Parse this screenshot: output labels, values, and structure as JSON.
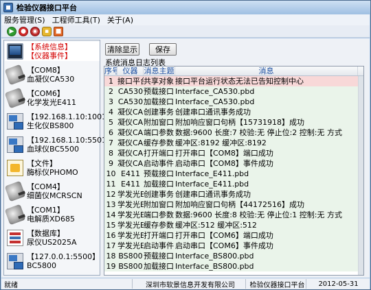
{
  "window": {
    "title": "检验仪器接口平台"
  },
  "menu": [
    {
      "label": "服务管理(S)"
    },
    {
      "label": "工程师工具(T)"
    },
    {
      "label": "关于(A)"
    }
  ],
  "toolbar": {
    "icons": [
      "play-icon",
      "stop-icon",
      "record-icon",
      "lock-icon",
      "exit-icon"
    ]
  },
  "devices": [
    {
      "line1": "【系统信息】",
      "line2": "【仪器事件】",
      "icon": "monitor-icon",
      "system": true
    },
    {
      "line1": "【COM8】",
      "line2": "血凝仪CA530",
      "icon": "serial-plug-icon"
    },
    {
      "line1": "【COM6】",
      "line2": "化学发光E411",
      "icon": "serial-plug-icon"
    },
    {
      "line1": "【192.168.1.10:1001】",
      "line2": "生化仪BS800",
      "icon": "network-icon"
    },
    {
      "line1": "【192.168.1.10:5501】",
      "line2": "血球仪BC5500",
      "icon": "network-icon"
    },
    {
      "line1": "【文件】",
      "line2": "酶标仪PHOMO",
      "icon": "file-icon"
    },
    {
      "line1": "【COM4】",
      "line2": "细菌仪MCRSCN",
      "icon": "serial-plug-icon"
    },
    {
      "line1": "【COM1】",
      "line2": "电解质XD685",
      "icon": "serial-plug-icon"
    },
    {
      "line1": "【数据库】",
      "line2": "尿仪US2025A",
      "icon": "database-icon"
    },
    {
      "line1": "【127.0.0.1:5500】",
      "line2": "BC5800",
      "icon": "network-icon"
    }
  ],
  "buttons": {
    "clear": "清除显示",
    "save": "保存"
  },
  "list": {
    "title": "系统消息日志列表",
    "columns": [
      "序号",
      "仪器",
      "消息主题",
      "消息"
    ],
    "rows": [
      {
        "no": "1",
        "device": "接口平台",
        "topic": "共享对象",
        "msg": "接口平台运行状态无法已告知控制中心",
        "highlight": true
      },
      {
        "no": "2",
        "device": "CA530",
        "topic": "预载接口",
        "msg": "Interface_CA530.pbd"
      },
      {
        "no": "3",
        "device": "CA530",
        "topic": "加载接口",
        "msg": "Interface_CA530.pbd"
      },
      {
        "no": "4",
        "device": "凝仪CA5",
        "topic": "创建事务",
        "msg": "创建串口通讯事务成功"
      },
      {
        "no": "5",
        "device": "凝仪CA5",
        "topic": "附加窗口",
        "msg": "附加响应窗口句柄【15731918】成功"
      },
      {
        "no": "6",
        "device": "凝仪CA5",
        "topic": "端口参数",
        "msg": "数据:9600 长度:7 校验:无 停止位:2 控制:无 方式"
      },
      {
        "no": "7",
        "device": "凝仪CA5",
        "topic": "缓存参数",
        "msg": "缓冲区:8192 缓冲区:8192"
      },
      {
        "no": "8",
        "device": "凝仪CA5",
        "topic": "打开端口",
        "msg": "打开串口【COM8】端口成功"
      },
      {
        "no": "9",
        "device": "凝仪CA5",
        "topic": "启动事件",
        "msg": "启动串口【COM8】事件成功"
      },
      {
        "no": "10",
        "device": "E411",
        "topic": "预载接口",
        "msg": "Interface_E411.pbd"
      },
      {
        "no": "11",
        "device": "E411",
        "topic": "加载接口",
        "msg": "Interface_E411.pbd"
      },
      {
        "no": "12",
        "device": "学发光E4",
        "topic": "创建事务",
        "msg": "创建串口通讯事务成功"
      },
      {
        "no": "13",
        "device": "学发光E4",
        "topic": "附加窗口",
        "msg": "附加响应窗口句柄【44172516】成功"
      },
      {
        "no": "14",
        "device": "学发光E4",
        "topic": "端口参数",
        "msg": "数据:9600 长度:8 校验:无 停止位:1 控制:无 方式"
      },
      {
        "no": "15",
        "device": "学发光E4",
        "topic": "缓存参数",
        "msg": "缓冲区:512 缓冲区:512"
      },
      {
        "no": "16",
        "device": "学发光E4",
        "topic": "打开端口",
        "msg": "打开串口【COM6】端口成功"
      },
      {
        "no": "17",
        "device": "学发光E4",
        "topic": "启动事件",
        "msg": "启动串口【COM6】事件成功"
      },
      {
        "no": "18",
        "device": "BS800",
        "topic": "预载接口",
        "msg": "Interface_BS800.pbd"
      },
      {
        "no": "19",
        "device": "BS800",
        "topic": "加载接口",
        "msg": "Interface_BS800.pbd"
      }
    ]
  },
  "status": {
    "ready": "就绪",
    "company": "深圳市软景信息开发有限公司",
    "app": "检验仪器接口平台",
    "date": "2012-05-31"
  },
  "colors": {
    "system_text": "#d40000",
    "row_bg": "#eaf4ea",
    "highlight_row_bg": "#f8d8d8",
    "header_text": "#1c4fa0"
  }
}
